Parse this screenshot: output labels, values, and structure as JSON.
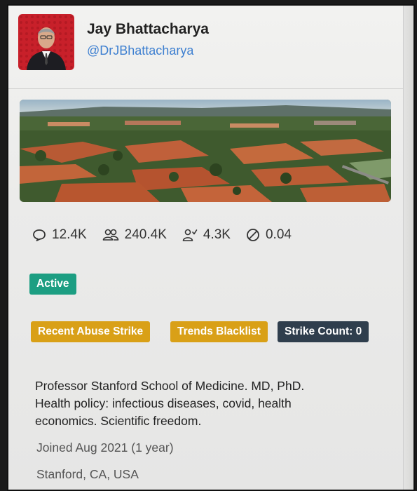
{
  "profile": {
    "name": "Jay Bhattacharya",
    "handle": "@DrJBhattacharya"
  },
  "stats": {
    "replies": "12.4K",
    "followers": "240.4K",
    "following": "4.3K",
    "ratio": "0.04"
  },
  "badges": {
    "status": "Active",
    "abuse": "Recent Abuse Strike",
    "trends": "Trends Blacklist",
    "strikes": "Strike Count: 0"
  },
  "bio": {
    "line1": "Professor Stanford School of Medicine. MD, PhD.",
    "line2": "Health policy: infectious diseases, covid, health",
    "line3": "economics. Scientific freedom."
  },
  "meta": {
    "joined": "Joined Aug 2021 (1 year)",
    "location": "Stanford, CA, USA"
  },
  "colors": {
    "active": "#1c9e82",
    "warning": "#d9a017",
    "dark_badge": "#2f3e4d",
    "handle": "#3d7fd0"
  },
  "icons": {
    "replies": "comment-icon",
    "followers": "users-icon",
    "following": "user-check-icon",
    "ratio": "slash-circle-icon"
  }
}
